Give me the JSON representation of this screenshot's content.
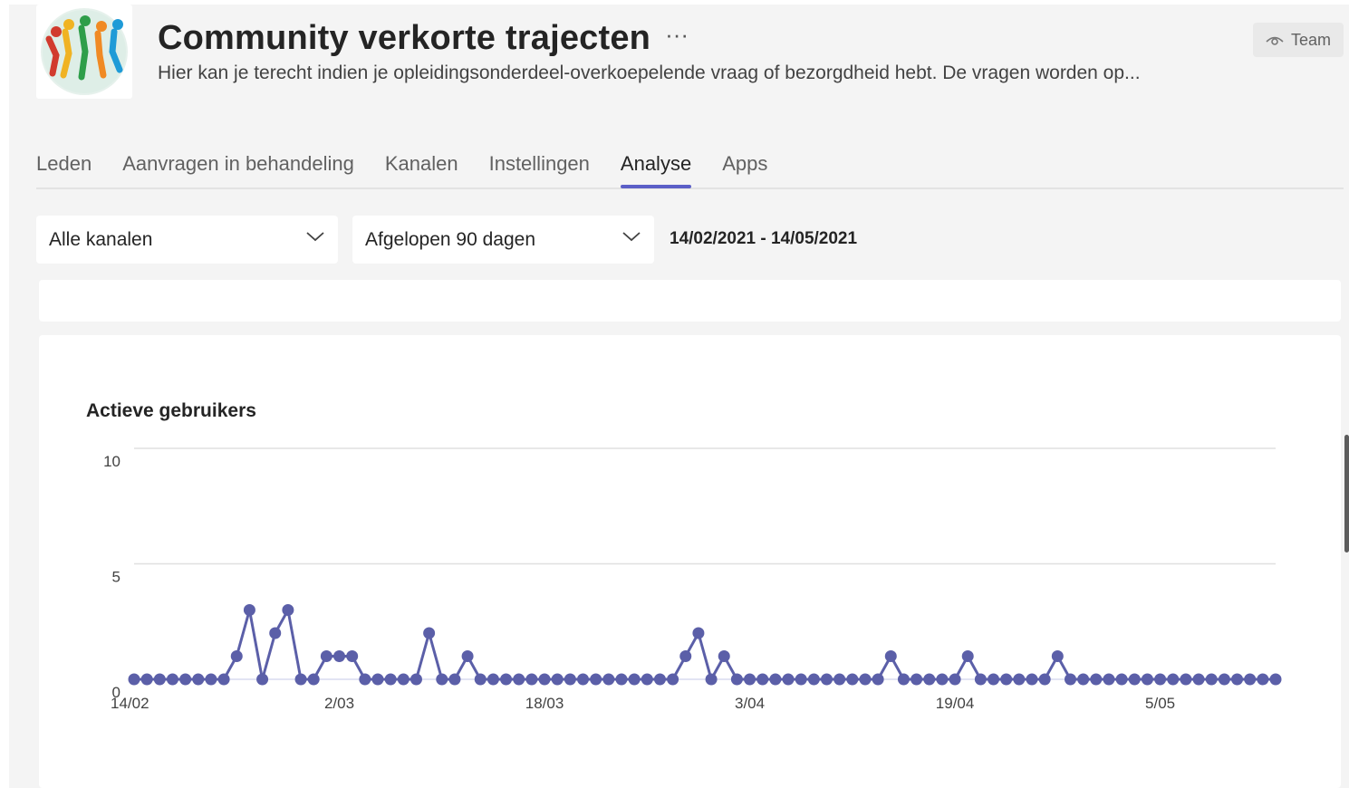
{
  "header": {
    "team_name": "Community verkorte trajecten",
    "more_glyph": "···",
    "description": "Hier kan je terecht indien je opleidingsonderdeel-overkoepelende vraag of bezorgdheid hebt. De vragen worden op...",
    "badge_label": "Team",
    "badge_icon": "eye-icon"
  },
  "tabs": [
    {
      "label": "Leden"
    },
    {
      "label": "Aanvragen in behandeling"
    },
    {
      "label": "Kanalen"
    },
    {
      "label": "Instellingen"
    },
    {
      "label": "Analyse",
      "active": true
    },
    {
      "label": "Apps"
    }
  ],
  "filters": {
    "channel": {
      "value": "Alle kanalen"
    },
    "period": {
      "value": "Afgelopen 90 dagen"
    },
    "date_range": "14/02/2021 - 14/05/2021"
  },
  "colors": {
    "accent": "#5b5fc7",
    "series": "#5b5fa8",
    "background": "#f4f4f4",
    "card": "#ffffff"
  },
  "chart_data": {
    "type": "line",
    "title": "Actieve gebruikers",
    "xlabel": "",
    "ylabel": "",
    "ylim": [
      0,
      10
    ],
    "y_ticks": [
      "0",
      "5",
      "10"
    ],
    "x_tick_labels": [
      "14/02",
      "2/03",
      "18/03",
      "3/04",
      "19/04",
      "5/05"
    ],
    "x_tick_indices": [
      0,
      16,
      32,
      48,
      64,
      80
    ],
    "grid": true,
    "legend": "none",
    "x_start": "14/02",
    "x_end": "14/05",
    "series": [
      {
        "values": [
          0,
          0,
          0,
          0,
          0,
          0,
          0,
          0,
          1,
          3,
          0,
          2,
          3,
          0,
          0,
          1,
          1,
          1,
          0,
          0,
          0,
          0,
          0,
          2,
          0,
          0,
          1,
          0,
          0,
          0,
          0,
          0,
          0,
          0,
          0,
          0,
          0,
          0,
          0,
          0,
          0,
          0,
          0,
          1,
          2,
          0,
          1,
          0,
          0,
          0,
          0,
          0,
          0,
          0,
          0,
          0,
          0,
          0,
          0,
          1,
          0,
          0,
          0,
          0,
          0,
          1,
          0,
          0,
          0,
          0,
          0,
          0,
          1,
          0,
          0,
          0,
          0,
          0,
          0,
          0,
          0,
          0,
          0,
          0,
          0,
          0,
          0,
          0,
          0,
          0
        ]
      }
    ]
  }
}
